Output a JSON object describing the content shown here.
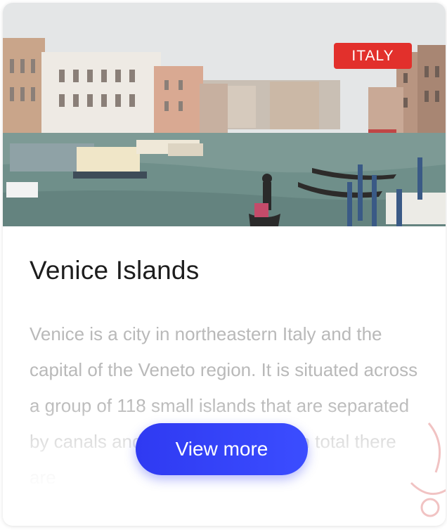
{
  "card": {
    "badge": "ITALY",
    "title": "Venice Islands",
    "description": "Venice is a city in northeastern Italy and the capital of the Veneto region. It is situated across a group of 118 small islands that are separated by canals and linked by bridges. In total there are",
    "button_label": "View more"
  },
  "colors": {
    "badge": "#e2302c",
    "button": "#2f3af2",
    "title": "#1d1d1d",
    "description": "#b9b9b9"
  }
}
